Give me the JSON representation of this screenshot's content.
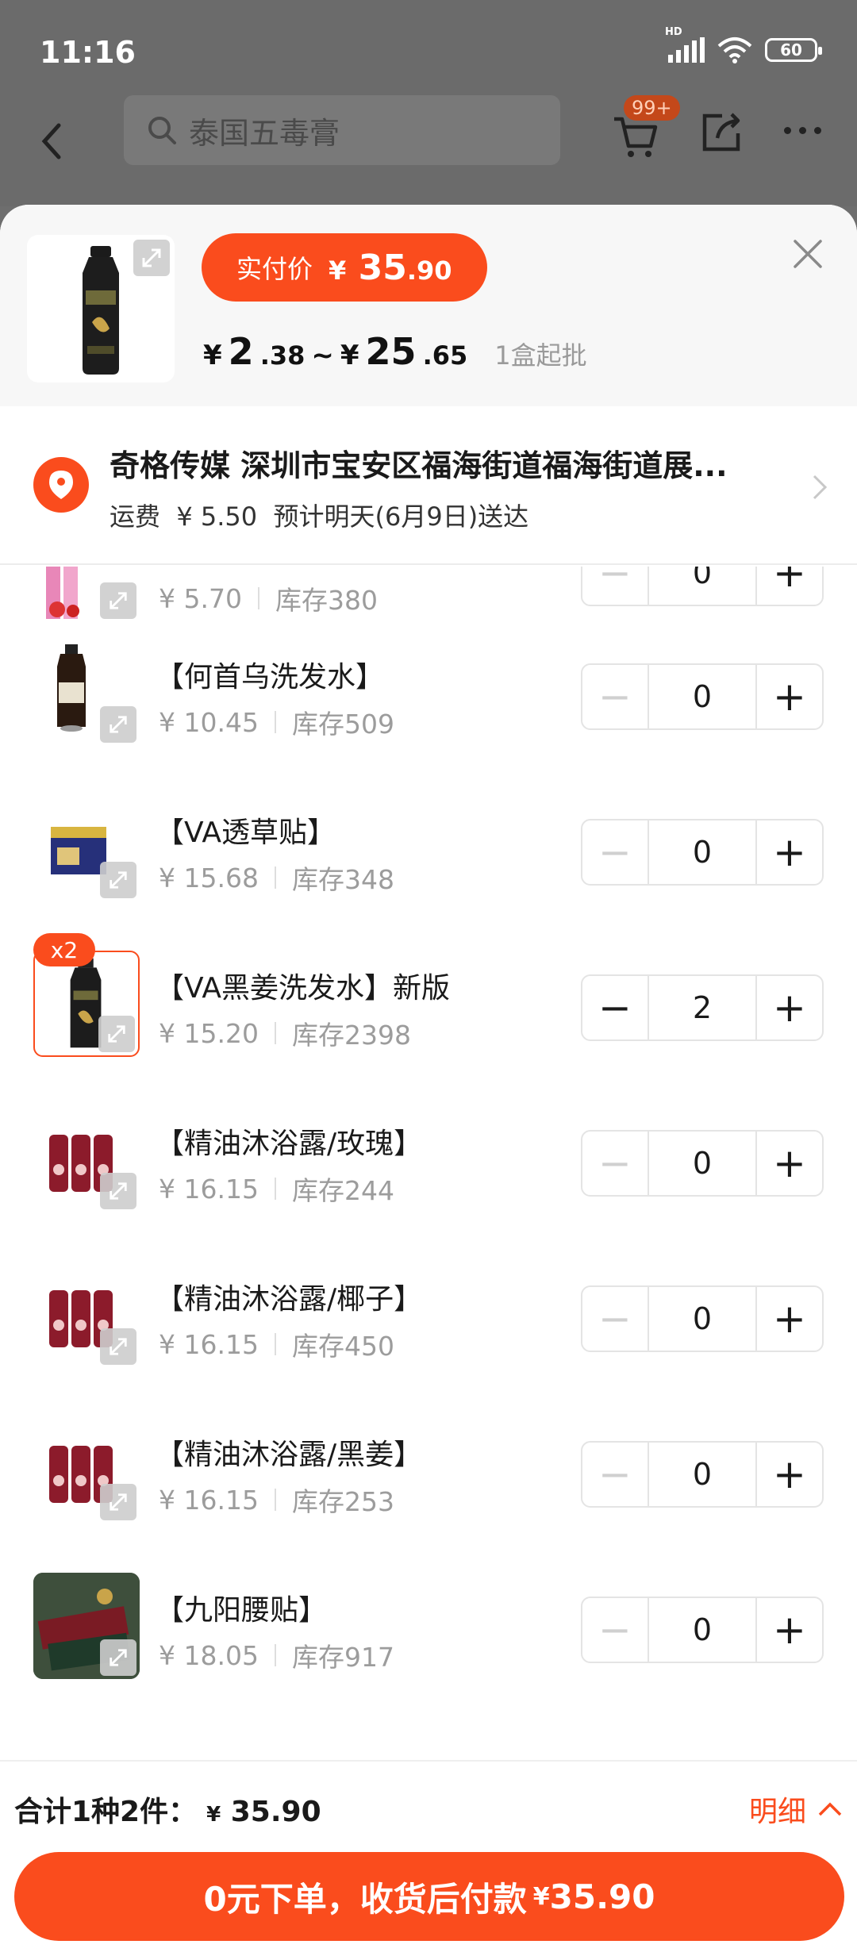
{
  "status_bar": {
    "time": "11:16",
    "network": "HD",
    "battery": "60"
  },
  "nav": {
    "search_placeholder": "泰国五毒膏",
    "cart_badge": "99+"
  },
  "sheet": {
    "pay_label": "实付价",
    "pay_currency": "¥",
    "pay_int": "35",
    "pay_dec": ".90",
    "range_from_int": "2",
    "range_from_dec": ".38",
    "range_sep": "~",
    "range_to_int": "25",
    "range_to_dec": ".65",
    "min_order": "1盒起批"
  },
  "address": {
    "line": "奇格传媒 深圳市宝安区福海街道福海街道展...",
    "shipping_label": "运费",
    "shipping_fee": "¥ 5.50",
    "delivery": "预计明天(6月9日)送达"
  },
  "items": [
    {
      "name": "",
      "price": "¥ 5.70",
      "stock": "库存380",
      "qty": "0",
      "selected": false
    },
    {
      "name": "【何首乌洗发水】",
      "price": "¥ 10.45",
      "stock": "库存509",
      "qty": "0",
      "selected": false
    },
    {
      "name": "【VA透草贴】",
      "price": "¥ 15.68",
      "stock": "库存348",
      "qty": "0",
      "selected": false
    },
    {
      "name": "【VA黑姜洗发水】新版",
      "price": "¥ 15.20",
      "stock": "库存2398",
      "qty": "2",
      "selected": true,
      "badge": "x2"
    },
    {
      "name": "【精油沐浴露/玫瑰】",
      "price": "¥ 16.15",
      "stock": "库存244",
      "qty": "0",
      "selected": false
    },
    {
      "name": "【精油沐浴露/椰子】",
      "price": "¥ 16.15",
      "stock": "库存450",
      "qty": "0",
      "selected": false
    },
    {
      "name": "【精油沐浴露/黑姜】",
      "price": "¥ 16.15",
      "stock": "库存253",
      "qty": "0",
      "selected": false
    },
    {
      "name": "【九阳腰贴】",
      "price": "¥ 18.05",
      "stock": "库存917",
      "qty": "0",
      "selected": false
    }
  ],
  "footer": {
    "total_label": "合计1种2件：",
    "total_currency": "¥",
    "total_amount": "35.90",
    "detail_label": "明细",
    "cta_label": "0元下单，收货后付款",
    "cta_currency": "¥",
    "cta_amount": "35.90"
  },
  "colors": {
    "accent": "#fa4c1d",
    "muted": "#9c9c9c"
  }
}
